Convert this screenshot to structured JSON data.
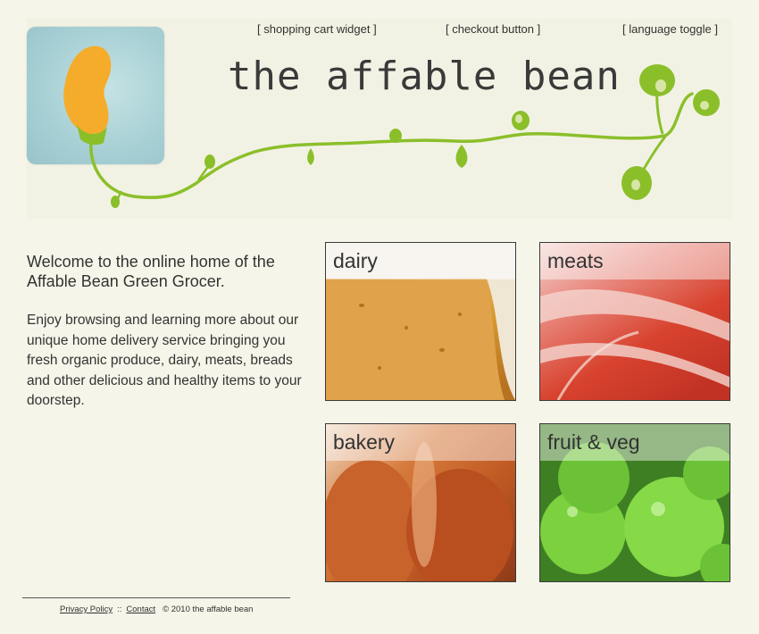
{
  "header": {
    "title": "the affable bean",
    "widgets": {
      "cart": "[ shopping cart widget ]",
      "checkout": "[ checkout button ]",
      "language": "[ language toggle ]"
    }
  },
  "colors": {
    "background": "#f5f5e9",
    "vine_green": "#8bbf2a",
    "bean_orange": "#f5ac2b",
    "logo_tile": "#a8d1d6",
    "text": "#333333"
  },
  "welcome": {
    "intro": "Welcome to the online home of the Affable Bean Green Grocer.",
    "body": "Enjoy browsing and learning more about our unique home delivery service bringing you fresh organic produce, dairy, meats, breads and other delicious and healthy items to your doorstep."
  },
  "categories": [
    {
      "label": "dairy",
      "image": "cheese-wedge"
    },
    {
      "label": "meats",
      "image": "cured-ham-slices"
    },
    {
      "label": "bakery",
      "image": "bread-loaves"
    },
    {
      "label": "fruit & veg",
      "image": "green-apples"
    }
  ],
  "footer": {
    "privacy": "Privacy Policy",
    "separator": "::",
    "contact": "Contact",
    "copyright": "©  2010 the affable bean"
  }
}
